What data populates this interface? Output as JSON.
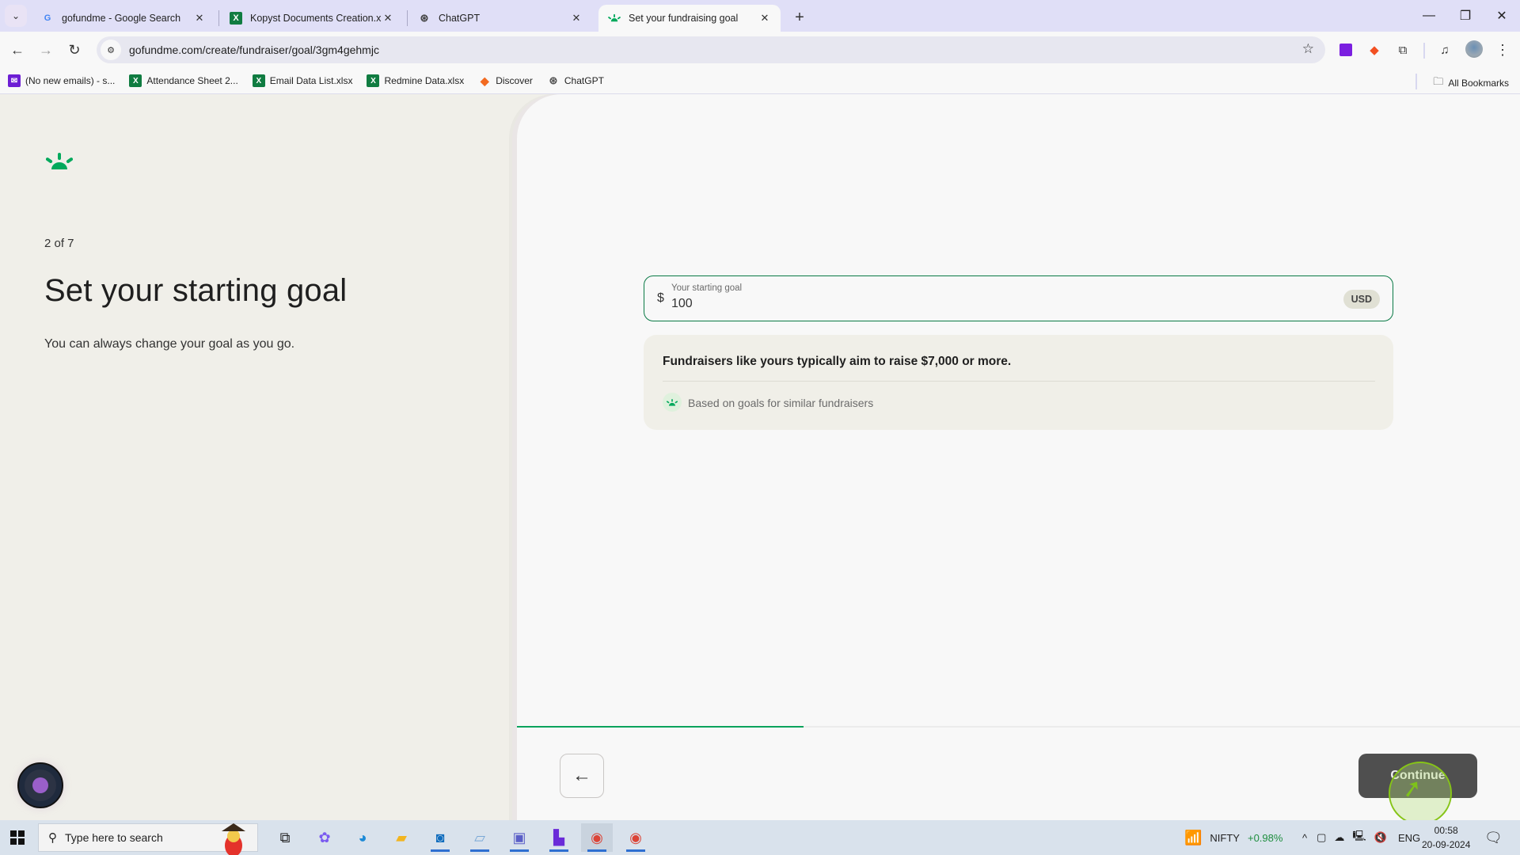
{
  "browser": {
    "tabs": [
      {
        "title": "gofundme - Google Search",
        "icon": "google-icon",
        "active": false
      },
      {
        "title": "Kopyst Documents Creation.xlsx",
        "icon": "excel-icon",
        "active": false
      },
      {
        "title": "ChatGPT",
        "icon": "chatgpt-icon",
        "active": false
      },
      {
        "title": "Set your fundraising goal",
        "icon": "gofundme-icon",
        "active": true
      }
    ],
    "url": "gofundme.com/create/fundraiser/goal/3gm4gehmjc",
    "bookmarks": [
      {
        "label": "(No new emails) - s...",
        "icon": "mail-icon"
      },
      {
        "label": "Attendance Sheet 2...",
        "icon": "excel-icon"
      },
      {
        "label": "Email Data List.xlsx",
        "icon": "excel-icon"
      },
      {
        "label": "Redmine Data.xlsx",
        "icon": "excel-icon"
      },
      {
        "label": "Discover",
        "icon": "discover-icon"
      },
      {
        "label": "ChatGPT",
        "icon": "chatgpt-icon"
      }
    ],
    "all_bookmarks_label": "All Bookmarks"
  },
  "page": {
    "step": "2 of 7",
    "heading": "Set your starting goal",
    "subtext": "You can always change your goal as you go.",
    "goal_field": {
      "currency_symbol": "$",
      "label": "Your starting goal",
      "value": "100",
      "currency_code": "USD"
    },
    "hint": {
      "main": "Fundraisers like yours typically aim to raise $7,000 or more.",
      "source": "Based on goals for similar fundraisers"
    },
    "progress": {
      "current_step": 2,
      "total_steps": 7
    },
    "back_label": "←",
    "continue_label": "Continue"
  },
  "colors": {
    "brand_green": "#02a95c",
    "field_border": "#0a7a46",
    "continue_bg": "#4f4f4f"
  },
  "taskbar": {
    "search_placeholder": "Type here to search",
    "stock": {
      "name": "NIFTY",
      "change": "+0.98%"
    },
    "language": "ENG",
    "time": "00:58",
    "date": "20-09-2024"
  }
}
